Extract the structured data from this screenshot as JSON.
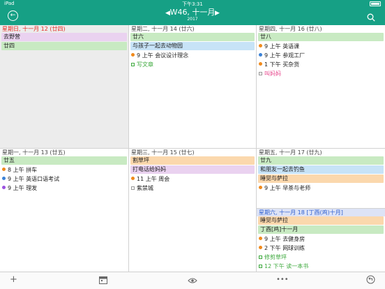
{
  "status_bar": {
    "carrier": "iPad",
    "time": "下午3:31"
  },
  "header": {
    "week": "W46, 十一月",
    "year": "2017"
  },
  "colors": {
    "header_bg": "#16a085",
    "green": "#c8eac2",
    "purple": "#ead2f0",
    "blue": "#c7e3f7",
    "orange": "#fbd8ad",
    "dot_orange": "#f08a1c",
    "dot_blue": "#3b82d6",
    "dot_purple": "#9b51e0",
    "today_red": "#e52b24",
    "done_green": "#3faa3f",
    "pink": "#e8488e"
  },
  "days": [
    {
      "header": "星期日, 十一月 12 (廿四)",
      "bars": [
        {
          "text": "去野营"
        },
        {
          "text": "廿四"
        }
      ],
      "events": []
    },
    {
      "header": "星期一, 十一月 13 (廿五)",
      "bars": [
        {
          "text": "廿五"
        }
      ],
      "events": [
        {
          "time": "8 上午",
          "title": "拼车"
        },
        {
          "time": "9 上午",
          "title": "英语口语考试"
        },
        {
          "time": "9 上午",
          "title": "理发"
        }
      ]
    },
    {
      "header": "星期二, 十一月 14 (廿六)",
      "bars": [
        {
          "text": "廿六"
        },
        {
          "text": "与孩子一起去动物园"
        }
      ],
      "events": [
        {
          "time": "9 上午",
          "title": "会议设计理念"
        },
        {
          "time": "",
          "title": "写文章"
        }
      ]
    },
    {
      "header": "星期三, 十一月 15 (廿七)",
      "bars": [
        {
          "text": "割草坪"
        },
        {
          "text": "打电话给妈妈"
        }
      ],
      "events": [
        {
          "time": "11 上午",
          "title": "周会"
        },
        {
          "time": "",
          "title": "紫禁城"
        }
      ]
    },
    {
      "header": "星期四, 十一月 16 (廿八)",
      "bars": [
        {
          "text": "廿八"
        }
      ],
      "events": [
        {
          "time": "9 上午",
          "title": "英语课"
        },
        {
          "time": "9 上午",
          "title": "参观工厂"
        },
        {
          "time": "1 下午",
          "title": "买杂货"
        },
        {
          "time": "",
          "title": "叫妈妈"
        }
      ]
    },
    {
      "header": "星期五, 十一月 17 (廿九)",
      "bars": [
        {
          "text": "廿九"
        },
        {
          "text": "和朋友一起去钓鱼"
        },
        {
          "text": "睡觉与萨拉"
        }
      ],
      "events": [
        {
          "time": "9 上午",
          "title": "早茶与老师"
        }
      ]
    },
    {
      "header": "星期六, 十一月 18 [丁酉(鸡)十月]",
      "bars": [
        {
          "text": "睡觉与萨拉"
        },
        {
          "text": "丁酉[鸡]十一月"
        }
      ],
      "events": [
        {
          "time": "9 上午",
          "title": "去健身房"
        },
        {
          "time": "2 下午",
          "title": "网球训练"
        },
        {
          "time": "",
          "title": "修剪草坪"
        },
        {
          "time": "12 下午",
          "title": "读一本书"
        }
      ]
    }
  ],
  "toolbar": {
    "add_icon": "plus-icon",
    "today_icon": "calendar-icon",
    "view_icon": "eye-icon",
    "more_icon": "ellipsis-icon",
    "sync_icon": "sync-icon"
  }
}
